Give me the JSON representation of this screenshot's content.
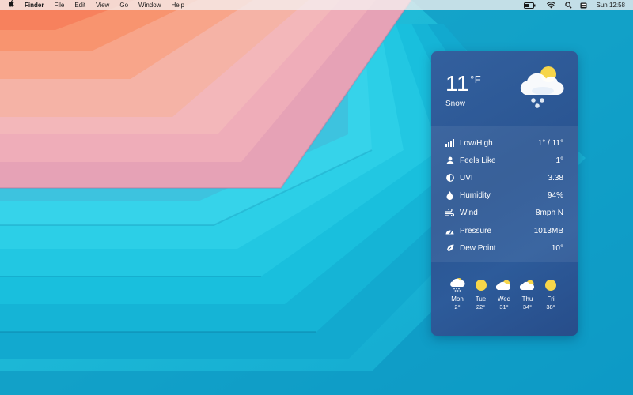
{
  "menubar": {
    "apple_icon": "apple-icon",
    "app_name": "Finder",
    "menus": [
      "File",
      "Edit",
      "View",
      "Go",
      "Window",
      "Help"
    ],
    "clock": "Sun 12:58"
  },
  "widget": {
    "temperature": "11",
    "unit": "°F",
    "condition": "Snow",
    "condition_icon": "cloud-sun-snow-icon",
    "details": [
      {
        "icon": "bar-chart-icon",
        "label": "Low/High",
        "value": "1° / 11°"
      },
      {
        "icon": "person-icon",
        "label": "Feels Like",
        "value": "1°"
      },
      {
        "icon": "half-circle-icon",
        "label": "UVI",
        "value": "3.38"
      },
      {
        "icon": "droplet-icon",
        "label": "Humidity",
        "value": "94%"
      },
      {
        "icon": "wind-icon",
        "label": "Wind",
        "value": "8mph N"
      },
      {
        "icon": "gauge-icon",
        "label": "Pressure",
        "value": "1013MB"
      },
      {
        "icon": "leaf-icon",
        "label": "Dew Point",
        "value": "10°"
      }
    ],
    "forecast": [
      {
        "day": "Mon",
        "temp": "2°",
        "icon": "snow-cloud-icon"
      },
      {
        "day": "Tue",
        "temp": "22°",
        "icon": "sun-icon"
      },
      {
        "day": "Wed",
        "temp": "31°",
        "icon": "partly-cloudy-icon"
      },
      {
        "day": "Thu",
        "temp": "34°",
        "icon": "partly-cloudy-icon"
      },
      {
        "day": "Fri",
        "temp": "38°",
        "icon": "sun-icon"
      }
    ]
  },
  "colors": {
    "widget_bg": "#2d5b9a",
    "sun": "#f7d64a",
    "wallpaper_warm": "#f4866a",
    "wallpaper_cool": "#17c4e0"
  }
}
